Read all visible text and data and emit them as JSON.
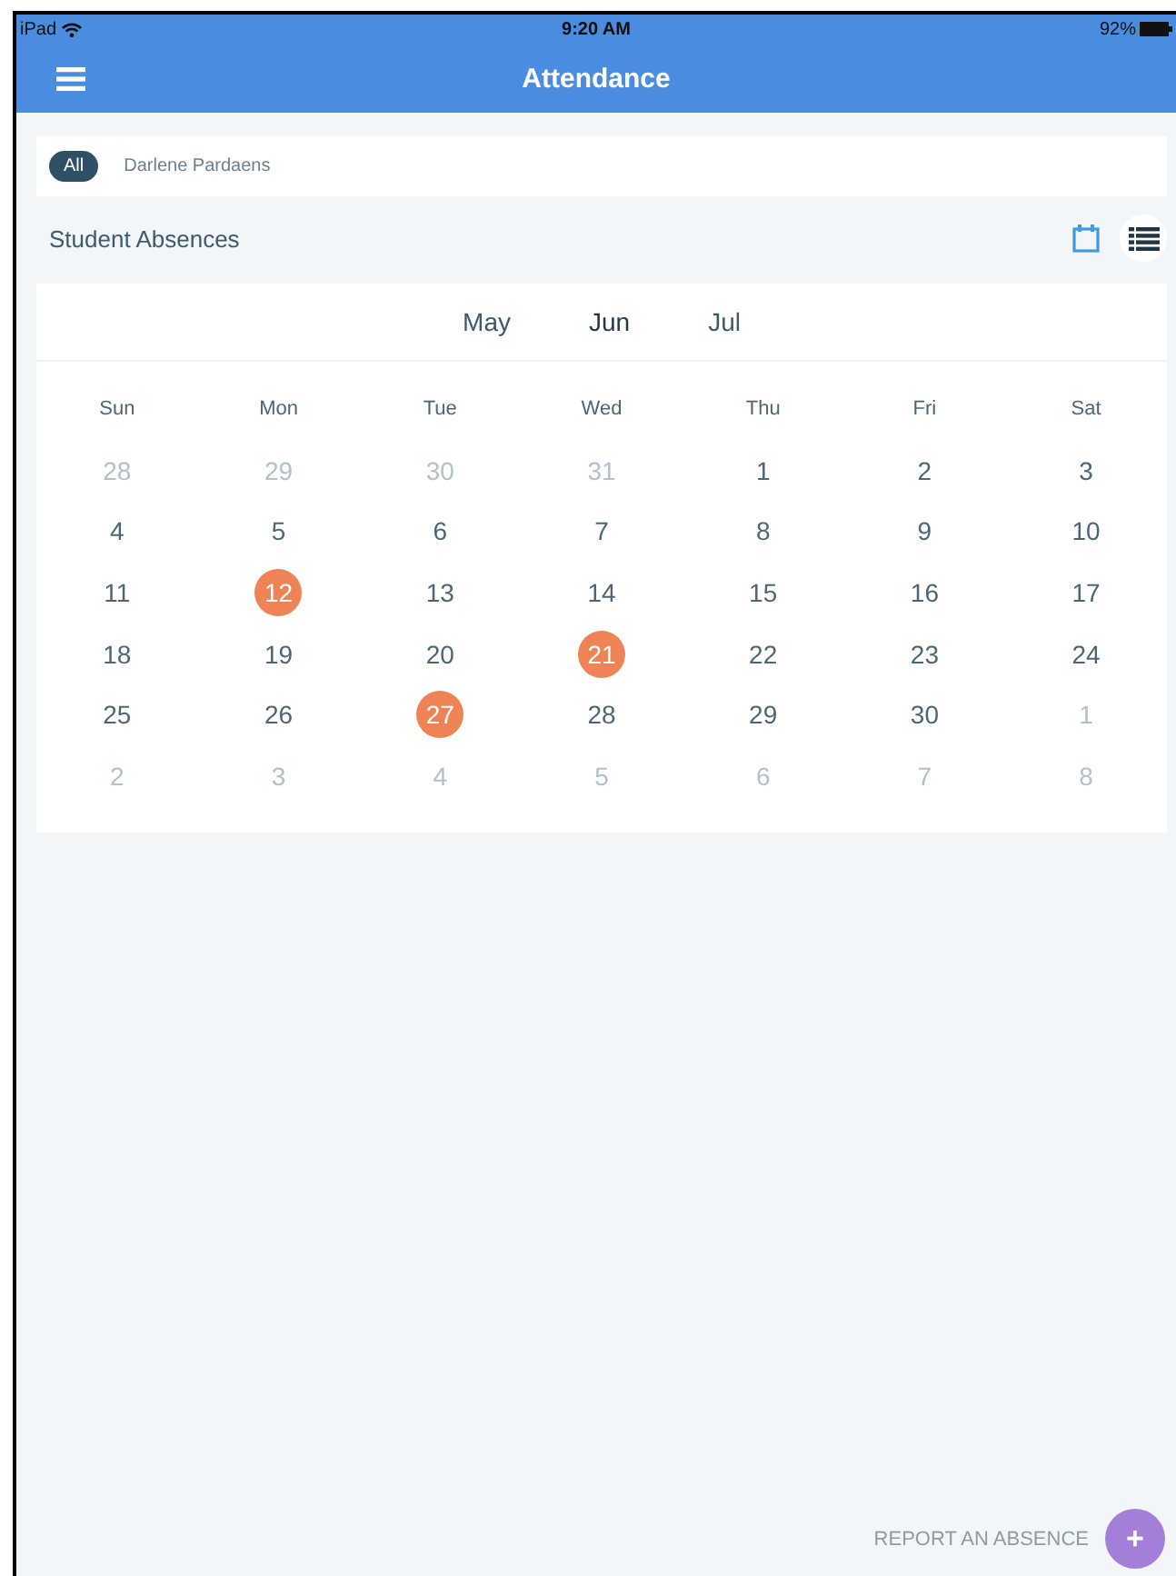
{
  "status_bar": {
    "device": "iPad",
    "time": "9:20 AM",
    "battery": "92%"
  },
  "nav_bar": {
    "title": "Attendance"
  },
  "filters": [
    {
      "label": "All",
      "selected": true
    },
    {
      "label": "Darlene Pardaens",
      "selected": false
    }
  ],
  "section": {
    "title": "Student Absences",
    "views": [
      {
        "kind": "calendar",
        "selected": true
      },
      {
        "kind": "list",
        "selected": false
      }
    ]
  },
  "calendar": {
    "months": [
      {
        "label": "May",
        "selected": false
      },
      {
        "label": "Jun",
        "selected": true
      },
      {
        "label": "Jul",
        "selected": false
      }
    ],
    "weekdays": [
      "Sun",
      "Mon",
      "Tue",
      "Wed",
      "Thu",
      "Fri",
      "Sat"
    ],
    "weeks": [
      [
        {
          "day": "28",
          "muted": true,
          "absent": false
        },
        {
          "day": "29",
          "muted": true,
          "absent": false
        },
        {
          "day": "30",
          "muted": true,
          "absent": false
        },
        {
          "day": "31",
          "muted": true,
          "absent": false
        },
        {
          "day": "1",
          "muted": false,
          "absent": false
        },
        {
          "day": "2",
          "muted": false,
          "absent": false
        },
        {
          "day": "3",
          "muted": false,
          "absent": false
        }
      ],
      [
        {
          "day": "4",
          "muted": false,
          "absent": false
        },
        {
          "day": "5",
          "muted": false,
          "absent": false
        },
        {
          "day": "6",
          "muted": false,
          "absent": false
        },
        {
          "day": "7",
          "muted": false,
          "absent": false
        },
        {
          "day": "8",
          "muted": false,
          "absent": false
        },
        {
          "day": "9",
          "muted": false,
          "absent": false
        },
        {
          "day": "10",
          "muted": false,
          "absent": false
        }
      ],
      [
        {
          "day": "11",
          "muted": false,
          "absent": false
        },
        {
          "day": "12",
          "muted": false,
          "absent": true
        },
        {
          "day": "13",
          "muted": false,
          "absent": false
        },
        {
          "day": "14",
          "muted": false,
          "absent": false
        },
        {
          "day": "15",
          "muted": false,
          "absent": false
        },
        {
          "day": "16",
          "muted": false,
          "absent": false
        },
        {
          "day": "17",
          "muted": false,
          "absent": false
        }
      ],
      [
        {
          "day": "18",
          "muted": false,
          "absent": false
        },
        {
          "day": "19",
          "muted": false,
          "absent": false
        },
        {
          "day": "20",
          "muted": false,
          "absent": false
        },
        {
          "day": "21",
          "muted": false,
          "absent": true
        },
        {
          "day": "22",
          "muted": false,
          "absent": false
        },
        {
          "day": "23",
          "muted": false,
          "absent": false
        },
        {
          "day": "24",
          "muted": false,
          "absent": false
        }
      ],
      [
        {
          "day": "25",
          "muted": false,
          "absent": false
        },
        {
          "day": "26",
          "muted": false,
          "absent": false
        },
        {
          "day": "27",
          "muted": false,
          "absent": true
        },
        {
          "day": "28",
          "muted": false,
          "absent": false
        },
        {
          "day": "29",
          "muted": false,
          "absent": false
        },
        {
          "day": "30",
          "muted": false,
          "absent": false
        },
        {
          "day": "1",
          "muted": true,
          "absent": false
        }
      ],
      [
        {
          "day": "2",
          "muted": true,
          "absent": false
        },
        {
          "day": "3",
          "muted": true,
          "absent": false
        },
        {
          "day": "4",
          "muted": true,
          "absent": false
        },
        {
          "day": "5",
          "muted": true,
          "absent": false
        },
        {
          "day": "6",
          "muted": true,
          "absent": false
        },
        {
          "day": "7",
          "muted": true,
          "absent": false
        },
        {
          "day": "8",
          "muted": true,
          "absent": false
        }
      ]
    ]
  },
  "report_action": {
    "label": "REPORT AN ABSENCE",
    "icon_text": "+"
  }
}
